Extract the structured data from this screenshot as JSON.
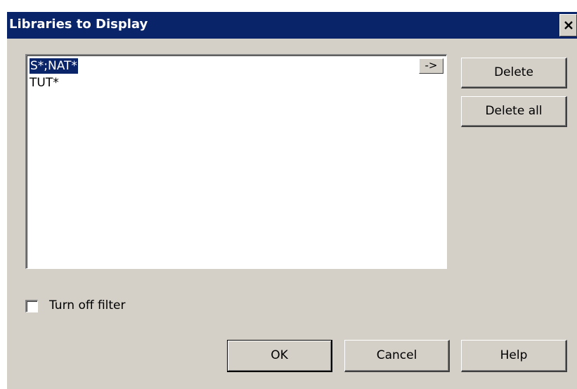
{
  "window": {
    "title": "Libraries to Display",
    "close_glyph": "✕"
  },
  "library_list": {
    "edit_value": "S*;NAT*",
    "arrow_label": "->",
    "items": [
      "TUT*"
    ]
  },
  "side_buttons": {
    "delete_label": "Delete",
    "delete_all_label": "Delete all"
  },
  "filter": {
    "label": "Turn off filter",
    "checked": false
  },
  "footer_buttons": {
    "ok_label": "OK",
    "cancel_label": "Cancel",
    "help_label": "Help"
  },
  "colors": {
    "titlebar": "#0a246a",
    "dialog_face": "#d4d0c8",
    "selection": "#0a246a"
  }
}
